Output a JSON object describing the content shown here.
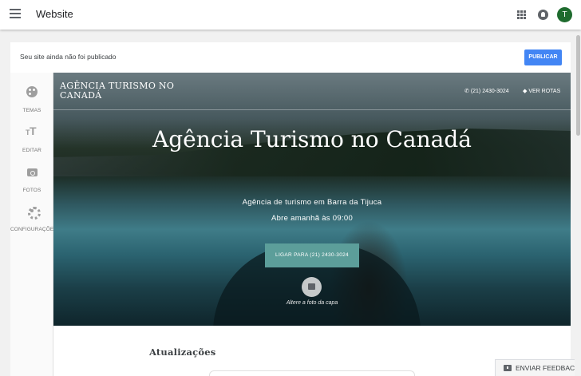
{
  "app": {
    "title": "Website",
    "avatar_initial": "T"
  },
  "notice": {
    "text": "Seu site ainda não foi publicado",
    "publish_label": "PUBLICAR"
  },
  "tools": [
    {
      "label": "TEMAS",
      "icon": "palette-icon"
    },
    {
      "label": "EDITAR",
      "icon": "text-size-icon"
    },
    {
      "label": "FOTOS",
      "icon": "add-photo-icon"
    },
    {
      "label": "CONFIGURAÇÕES",
      "icon": "gear-icon"
    }
  ],
  "hero": {
    "brand": "AGÊNCIA TURISMO NO CANADÁ",
    "phone": "(21) 2430-3024",
    "route": "VER ROTAS",
    "title": "Agência Turismo no Canadá",
    "subtitle": "Agência de turismo em Barra da Tijuca",
    "hours": "Abre amanhã às 09:00",
    "call_label": "LIGAR PARA (21) 2430-3024",
    "cover_label": "Altere a foto da capa"
  },
  "content": {
    "updates_title": "Atualizações"
  },
  "feedback": {
    "label": "ENVIAR FEEDBACK"
  },
  "colors": {
    "accent": "#4285f4",
    "call_button": "#5c9e9a",
    "avatar": "#1e6b2e"
  }
}
